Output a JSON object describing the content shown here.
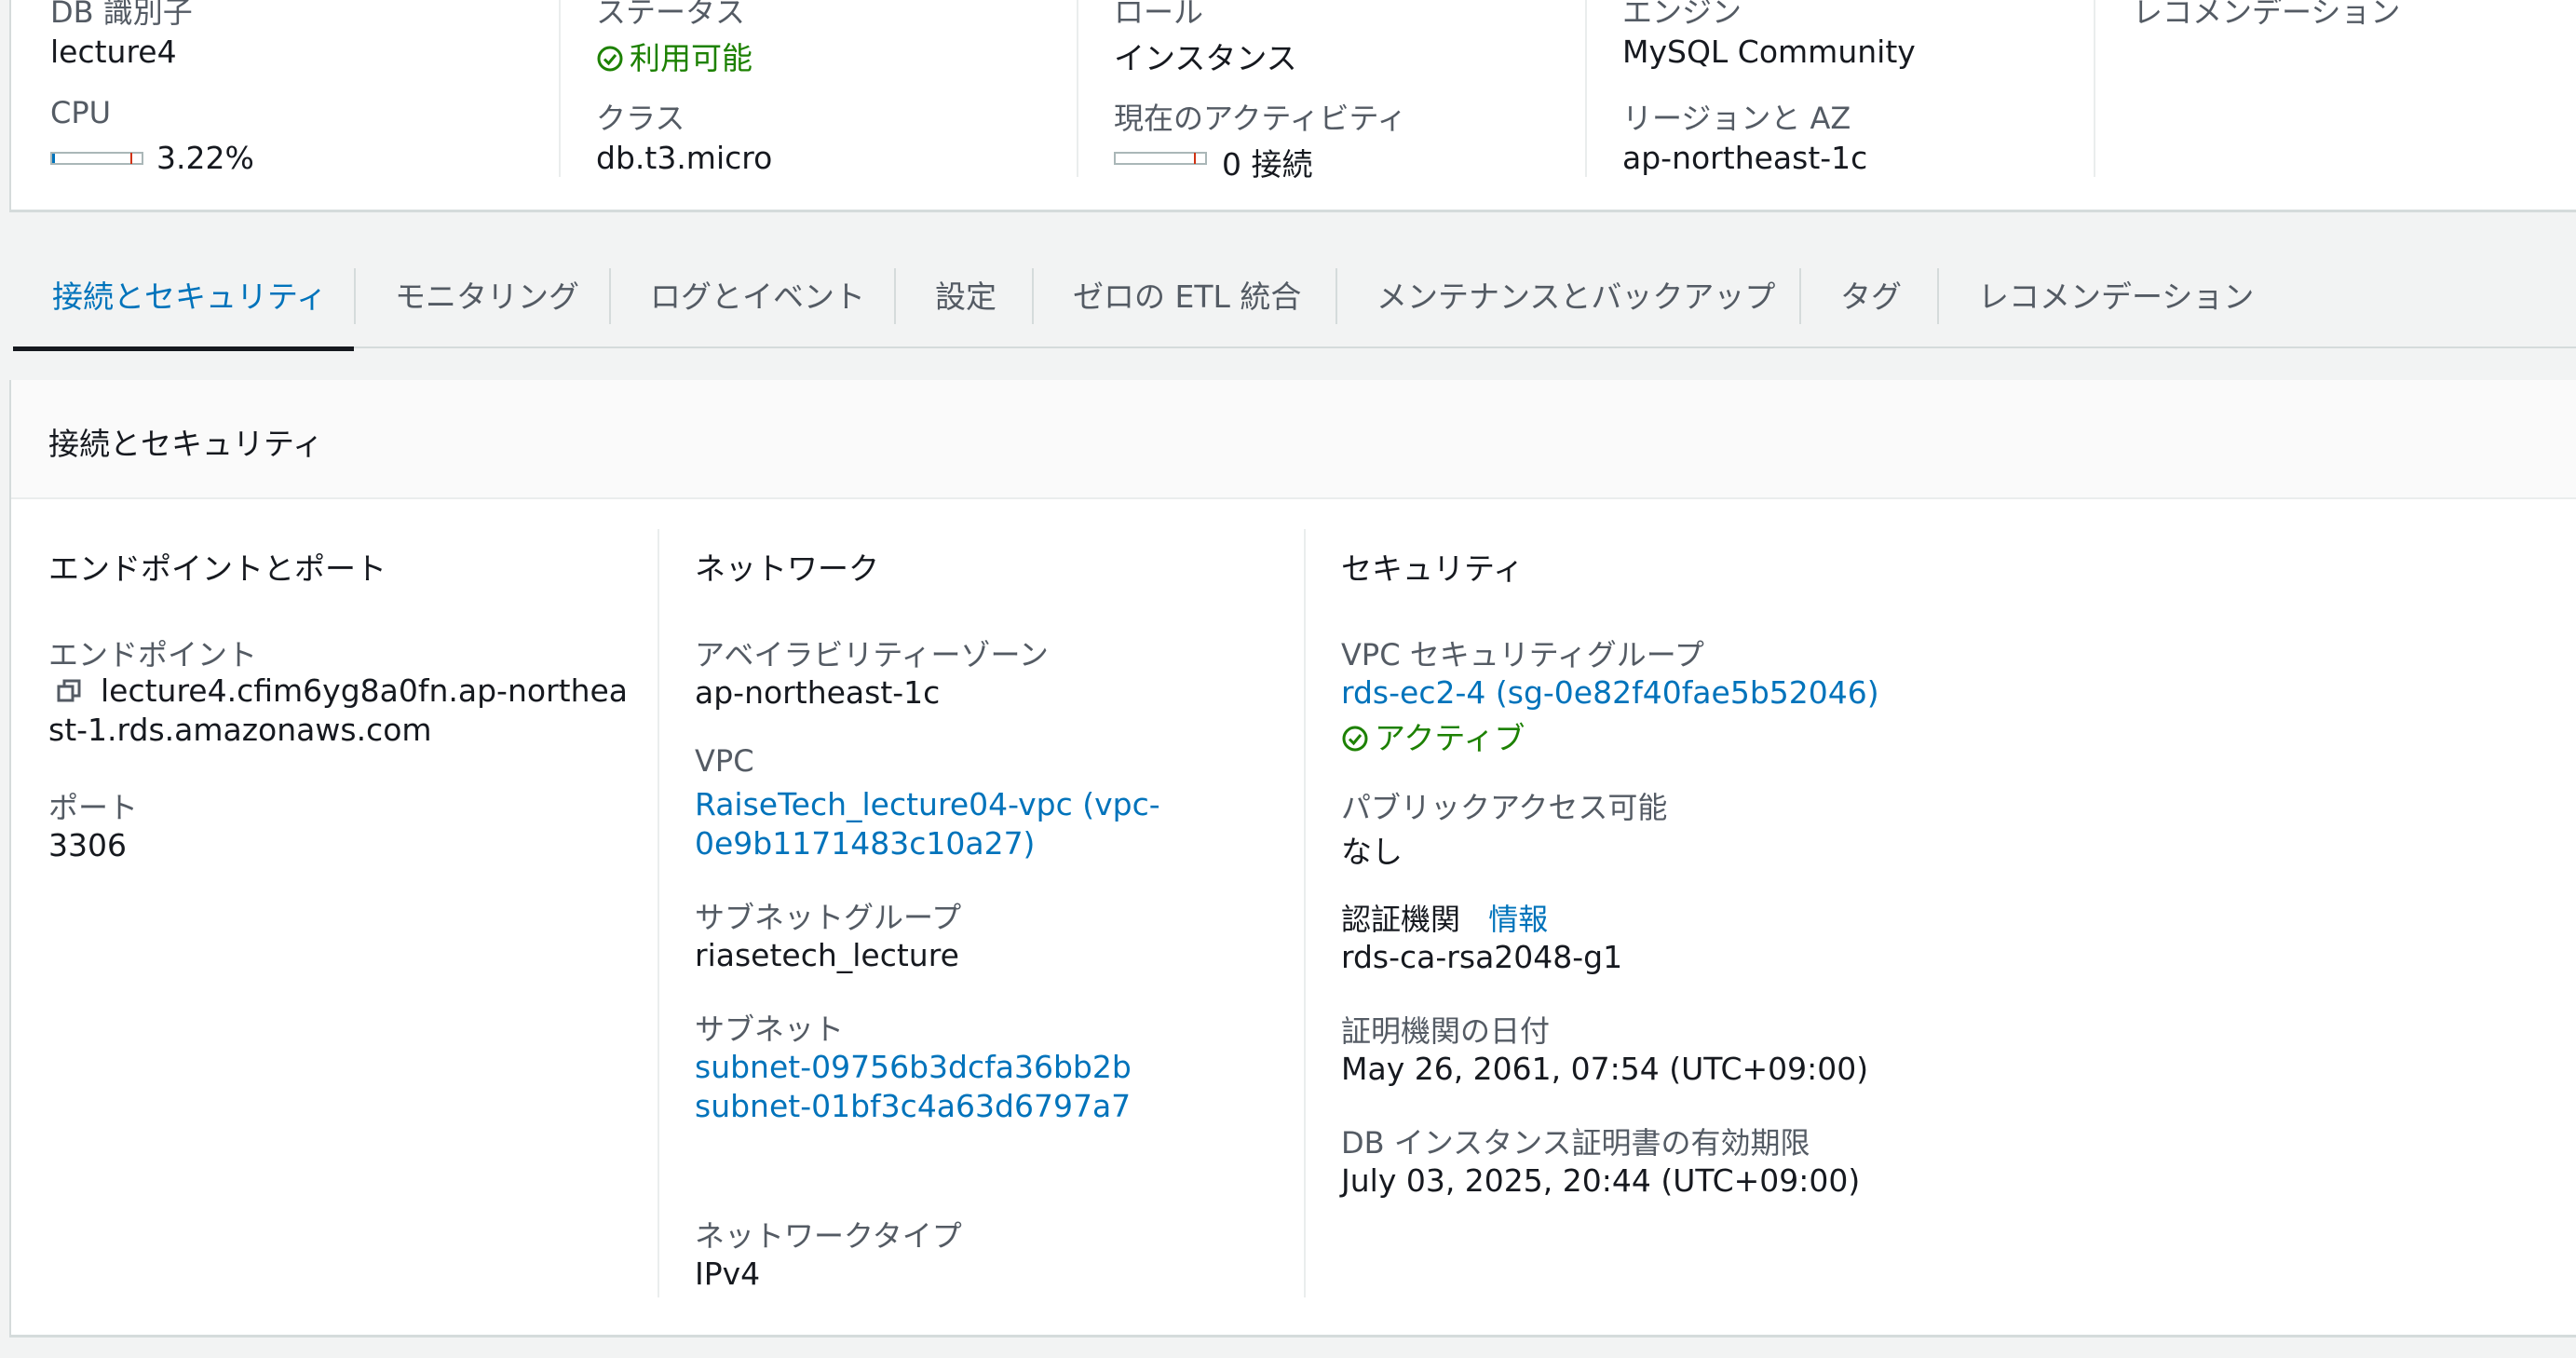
{
  "summary": {
    "db_identifier_label": "DB 識別子",
    "db_identifier": "lecture4",
    "cpu_label": "CPU",
    "cpu_value": "3.22%",
    "cpu_fraction": 0.0322,
    "status_label": "ステータス",
    "status_value": "利用可能",
    "class_label": "クラス",
    "class_value": "db.t3.micro",
    "role_label": "ロール",
    "role_value": "インスタンス",
    "activity_label": "現在のアクティビティ",
    "activity_value": "0 接続",
    "engine_label": "エンジン",
    "engine_value": "MySQL Community",
    "region_label": "リージョンと AZ",
    "region_value": "ap-northeast-1c",
    "recommendation_label": "レコメンデーション"
  },
  "tabs": [
    {
      "label": "接続とセキュリティ",
      "active": true
    },
    {
      "label": "モニタリング",
      "active": false
    },
    {
      "label": "ログとイベント",
      "active": false
    },
    {
      "label": "設定",
      "active": false
    },
    {
      "label": "ゼロの ETL 統合",
      "active": false
    },
    {
      "label": "メンテナンスとバックアップ",
      "active": false
    },
    {
      "label": "タグ",
      "active": false
    },
    {
      "label": "レコメンデーション",
      "active": false
    }
  ],
  "panel": {
    "title": "接続とセキュリティ",
    "endpoint_section": {
      "title": "エンドポイントとポート",
      "endpoint_label": "エンドポイント",
      "endpoint_line1": "lecture4.cfim6yg8a0fn.ap-northea",
      "endpoint_line2": "st-1.rds.amazonaws.com",
      "port_label": "ポート",
      "port_value": "3306"
    },
    "network_section": {
      "title": "ネットワーク",
      "az_label": "アベイラビリティーゾーン",
      "az_value": "ap-northeast-1c",
      "vpc_label": "VPC",
      "vpc_line1": "RaiseTech_lecture04-vpc (vpc-",
      "vpc_line2": "0e9b1171483c10a27)",
      "subnet_group_label": "サブネットグループ",
      "subnet_group_value": "riasetech_lecture",
      "subnets_label": "サブネット",
      "subnets": [
        "subnet-09756b3dcfa36bb2b",
        "subnet-01bf3c4a63d6797a7"
      ],
      "network_type_label": "ネットワークタイプ",
      "network_type_value": "IPv4"
    },
    "security_section": {
      "title": "セキュリティ",
      "sg_label": "VPC セキュリティグループ",
      "sg_link": "rds-ec2-4 (sg-0e82f40fae5b52046)",
      "sg_status": "アクティブ",
      "public_label": "パブリックアクセス可能",
      "public_value": "なし",
      "ca_label": "認証機関",
      "ca_info": "情報",
      "ca_value": "rds-ca-rsa2048-g1",
      "ca_date_label": "証明機関の日付",
      "ca_date_value": "May 26, 2061, 07:54 (UTC+09:00)",
      "cert_expiry_label": "DB インスタンス証明書の有効期限",
      "cert_expiry_value": "July 03, 2025, 20:44 (UTC+09:00)"
    }
  },
  "colors": {
    "link": "#0073bb",
    "success": "#1d8102",
    "text": "#16191f",
    "muted": "#545b64"
  }
}
